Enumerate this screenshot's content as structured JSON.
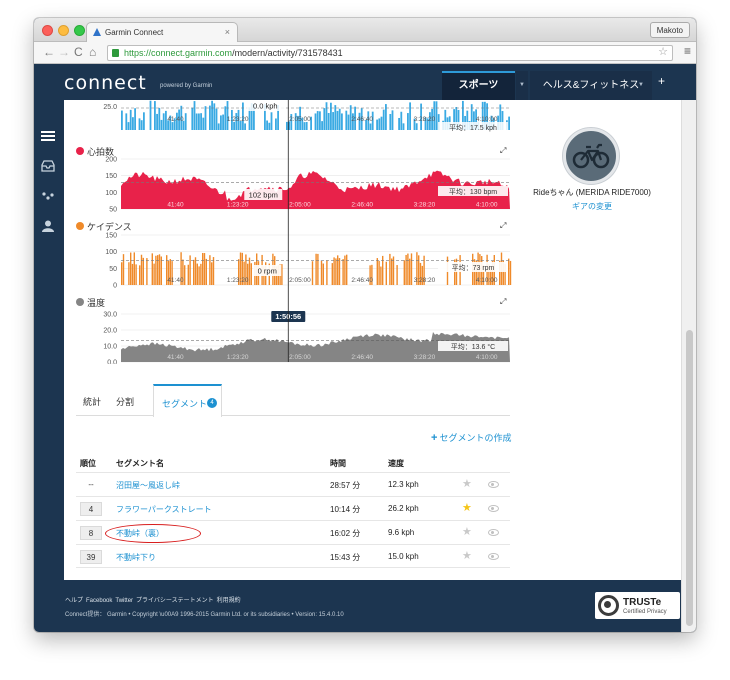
{
  "browser": {
    "tab_title": "Garmin Connect",
    "url_secure": "https://connect.garmin.com",
    "url_path": "/modern/activity/731578431",
    "user": "Makoto"
  },
  "app": {
    "logo": "connect",
    "powered": "powered by Garmin",
    "nav_sports": "スポーツ",
    "nav_health": "ヘルス&フィットネス",
    "nav_plus": "+"
  },
  "charts": {
    "speed": {
      "y_ticks": [
        "25.0"
      ],
      "tooltip": "0.0 kph",
      "avg": "平均：17.5 kph",
      "color": "#3aaae3"
    },
    "heart_rate": {
      "title": "心拍数",
      "y_ticks": [
        "200",
        "150",
        "100",
        "50"
      ],
      "tooltip": "102 bpm",
      "avg": "平均：130 bpm",
      "color": "#e8224a"
    },
    "cadence": {
      "title": "ケイデンス",
      "y_ticks": [
        "150",
        "100",
        "50",
        "0"
      ],
      "tooltip": "0 rpm",
      "avg": "平均：73 rpm",
      "color": "#ef8a2a"
    },
    "temperature": {
      "title": "温度",
      "y_ticks": [
        "30.0",
        "20.0",
        "10.0",
        "0.0"
      ],
      "tooltip": "1:50:56",
      "avg": "平均：13.6 °C",
      "color": "#858585"
    },
    "x_ticks": [
      "41:40",
      "1:23:20",
      "2:05:00",
      "2:46:40",
      "3:28:20",
      "4:10:00"
    ]
  },
  "chart_data": [
    {
      "type": "bar",
      "series_name": "心拍数",
      "x_ticks": [
        "41:40",
        "1:23:20",
        "2:05:00",
        "2:46:40",
        "3:28:20",
        "4:10:00"
      ],
      "ylim": [
        50,
        200
      ],
      "average": 130,
      "cursor_value": 102,
      "cursor_time": "1:50:56"
    },
    {
      "type": "bar",
      "series_name": "ケイデンス",
      "x_ticks": [
        "41:40",
        "1:23:20",
        "2:05:00",
        "2:46:40",
        "3:28:20",
        "4:10:00"
      ],
      "ylim": [
        0,
        150
      ],
      "average": 73,
      "cursor_value": 0,
      "cursor_time": "1:50:56"
    },
    {
      "type": "area",
      "series_name": "温度",
      "x_ticks": [
        "41:40",
        "1:23:20",
        "2:05:00",
        "2:46:40",
        "3:28:20",
        "4:10:00"
      ],
      "ylim": [
        0,
        30
      ],
      "average": 13.6,
      "cursor_time": "1:50:56"
    }
  ],
  "segments": {
    "tabs": [
      "統計",
      "分割",
      "セグメント"
    ],
    "badge": "4",
    "create": "セグメントの作成",
    "headers": {
      "rank": "順位",
      "name": "セグメント名",
      "time": "時間",
      "speed": "速度"
    },
    "rows": [
      {
        "rank": "--",
        "name": "沼田屋〜風返し峠",
        "time": "28:57 分",
        "speed": "12.3 kph",
        "star": "★"
      },
      {
        "rank": "4",
        "name": "フラワーパークストレート",
        "time": "10:14 分",
        "speed": "26.2 kph",
        "star": "★"
      },
      {
        "rank": "8",
        "name": "不動峠（裏）",
        "time": "16:02 分",
        "speed": "9.6 kph",
        "star": "★"
      },
      {
        "rank": "39",
        "name": "不動峠下り",
        "time": "15:43 分",
        "speed": "15.0 kph",
        "star": "★"
      }
    ]
  },
  "bike": {
    "name": "Rideちゃん (MERIDA RIDE7000)",
    "link": "ギアの変更"
  },
  "footer": {
    "links": [
      "ヘルプ",
      "Facebook",
      "Twitter",
      "プライバシーステートメント",
      "利用規約"
    ],
    "copyright": "Connect提供： Garmin • Copyright \\u00A9 1996-2015 Garmin Ltd. or its subsidiaries • Version: 15.4.0.10",
    "truste": "TRUSTe",
    "truste_sub": "Certified Privacy"
  },
  "colors": {
    "accent": "#1d91d1",
    "navy": "#1c3550",
    "favorite_star": "#f5c518",
    "annotation": "#d81e1e"
  }
}
